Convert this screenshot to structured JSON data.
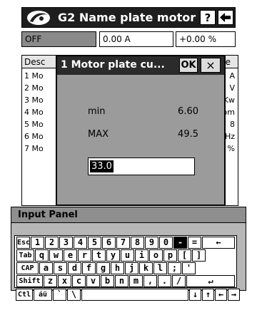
{
  "app": {
    "title": "G2 Name plate motor",
    "help_label": "?",
    "back_icon": "back-arrow-icon",
    "logo_icon": "brand-logo-icon"
  },
  "status": {
    "state": "OFF",
    "current": "0.00 A",
    "percent": "+0.00 %"
  },
  "table": {
    "headers": [
      "Desc",
      "ue"
    ],
    "rows": [
      {
        "desc": "1 Mo",
        "unit": "A"
      },
      {
        "desc": "2 Mo",
        "unit": "V"
      },
      {
        "desc": "3 Mo",
        "unit": "Kw"
      },
      {
        "desc": "4 Mo",
        "unit": "om"
      },
      {
        "desc": "5 Mo",
        "unit": "8"
      },
      {
        "desc": "6 Mo",
        "unit": "Hz"
      },
      {
        "desc": "7 Mo",
        "unit": "%"
      }
    ]
  },
  "dialog": {
    "title": "1 Motor plate cu...",
    "ok_label": "OK",
    "close_label": "×",
    "min_label": "min",
    "min_value": "6.60",
    "max_label": "MAX",
    "max_value": "49.5",
    "input_value": "33.0"
  },
  "input_panel": {
    "title": "Input Panel",
    "rows": [
      [
        "Esc",
        "1",
        "2",
        "3",
        "4",
        "5",
        "6",
        "7",
        "8",
        "9",
        "0",
        "-",
        "=",
        "←"
      ],
      [
        "Tab",
        "q",
        "w",
        "e",
        "r",
        "t",
        "y",
        "u",
        "i",
        "o",
        "p",
        "[",
        "]"
      ],
      [
        "CAP",
        "a",
        "s",
        "d",
        "f",
        "g",
        "h",
        "j",
        "k",
        "l",
        ";",
        "'"
      ],
      [
        "Shift",
        "z",
        "x",
        "c",
        "v",
        "b",
        "n",
        "m",
        ",",
        ".",
        "/",
        "↵"
      ],
      [
        "Ctl",
        "áü",
        "`",
        "\\",
        "",
        "↓",
        "↑",
        "←",
        "→"
      ]
    ]
  }
}
